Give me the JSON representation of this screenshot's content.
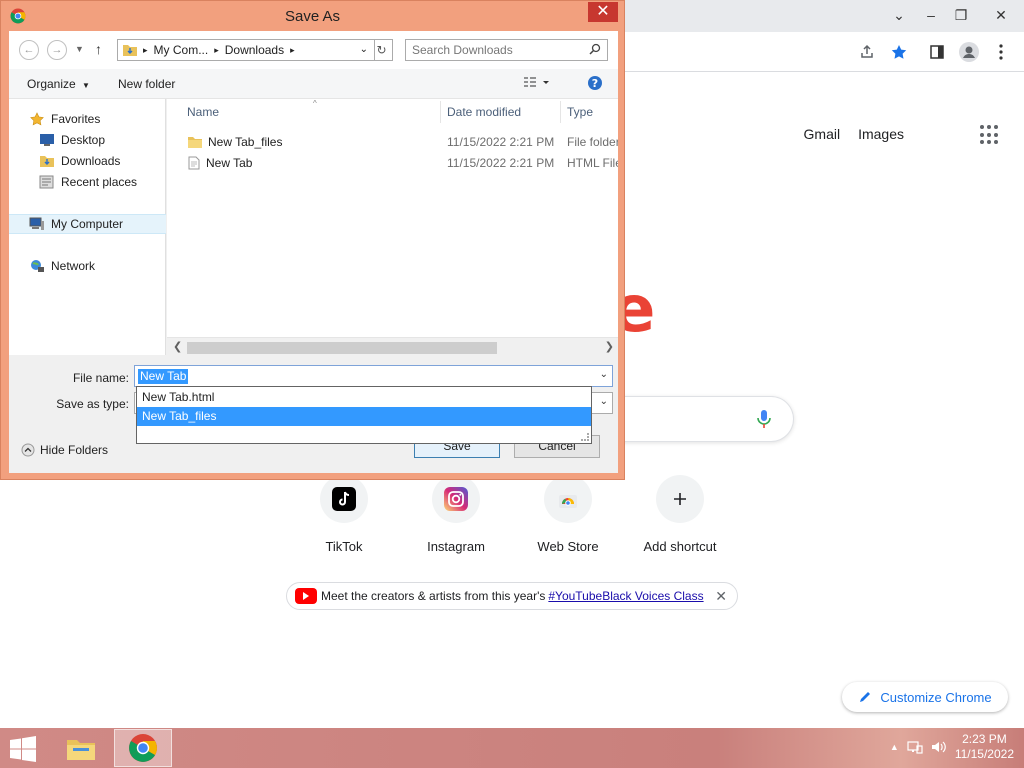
{
  "dialog": {
    "title": "Save As",
    "close_glyph": "✕",
    "breadcrumb": [
      "My Com...",
      "Downloads"
    ],
    "search_placeholder": "Search Downloads",
    "organize_label": "Organize",
    "new_folder_label": "New folder",
    "nav": {
      "favorites": "Favorites",
      "desktop": "Desktop",
      "downloads": "Downloads",
      "recent": "Recent places",
      "computer": "My Computer",
      "network": "Network"
    },
    "columns": {
      "name": "Name",
      "date": "Date modified",
      "type": "Type"
    },
    "files": [
      {
        "name": "New Tab_files",
        "date": "11/15/2022 2:21 PM",
        "type": "File folder",
        "icon": "folder-icon"
      },
      {
        "name": "New Tab",
        "date": "11/15/2022 2:21 PM",
        "type": "HTML File",
        "icon": "html-file-icon"
      }
    ],
    "file_name_label": "File name:",
    "file_name_value": "New Tab",
    "save_type_label": "Save as type:",
    "autocomplete": [
      "New Tab.html",
      "New Tab_files"
    ],
    "save_label": "Save",
    "cancel_label": "Cancel",
    "hide_folders_label": "Hide Folders"
  },
  "chrome": {
    "links": [
      "Gmail",
      "Images"
    ],
    "shortcuts": [
      {
        "label": "TikTok",
        "icon": "tiktok-icon"
      },
      {
        "label": "Instagram",
        "icon": "instagram-icon"
      },
      {
        "label": "Web Store",
        "icon": "webstore-icon"
      },
      {
        "label": "Add shortcut",
        "icon": "plus-icon"
      }
    ],
    "promo_text": "Meet the creators & artists from this year's",
    "promo_link": "#YouTubeBlack Voices Class",
    "customize_label": "Customize Chrome",
    "colors": {
      "accent": "#1a73e8",
      "star": "#1a73e8"
    }
  },
  "taskbar": {
    "time": "2:23 PM",
    "date": "11/15/2022",
    "colors": {
      "bar": "#c9807c"
    }
  }
}
